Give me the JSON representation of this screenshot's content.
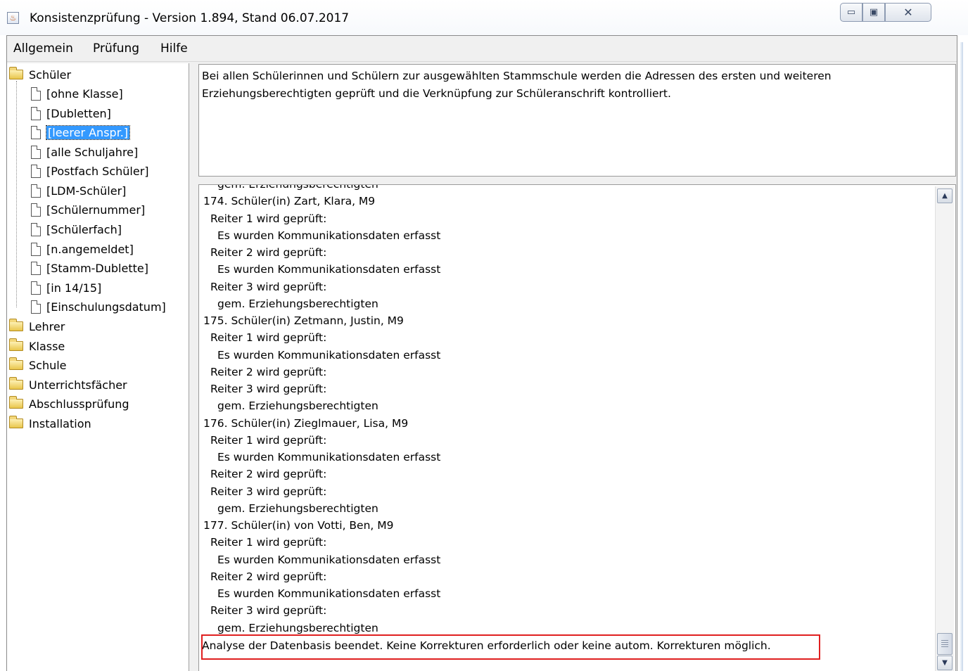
{
  "window": {
    "title": "Konsistenzprüfung - Version 1.894, Stand 06.07.2017",
    "minimize_glyph": "▭",
    "maximize_glyph": "▣",
    "close_glyph": "✕"
  },
  "menu": {
    "items": [
      "Allgemein",
      "Prüfung",
      "Hilfe"
    ]
  },
  "tree": {
    "root": "Schüler",
    "children": [
      "[ohne Klasse]",
      "[Dubletten]",
      "[leerer Anspr.]",
      "[alle Schuljahre]",
      "[Postfach Schüler]",
      "[LDM-Schüler]",
      "[Schülernummer]",
      "[Schülerfach]",
      "[n.angemeldet]",
      "[Stamm-Dublette]",
      "[in 14/15]",
      "[Einschulungsdatum]"
    ],
    "selected": "[leerer Anspr.]",
    "folders": [
      "Lehrer",
      "Klasse",
      "Schule",
      "Unterrichtsfächer",
      "Abschlussprüfung",
      "Installation"
    ]
  },
  "description": {
    "line1": "Bei allen Schülerinnen und Schülern zur ausgewählten Stammschule werden die Adressen des ersten und weiteren",
    "line2": "Erziehungsberechtigten geprüft und die Verknüpfung zur Schüleranschrift kontrolliert."
  },
  "log": {
    "lines": [
      "gem. Erziehungsberechtigten",
      "174. Schüler(in) Zart, Klara, M9",
      "Reiter 1 wird geprüft:",
      "Es wurden Kommunikationsdaten erfasst",
      "Reiter 2 wird geprüft:",
      "Es wurden Kommunikationsdaten erfasst",
      "Reiter 3 wird geprüft:",
      "gem. Erziehungsberechtigten",
      "175. Schüler(in) Zetmann, Justin, M9",
      "Reiter 1 wird geprüft:",
      "Es wurden Kommunikationsdaten erfasst",
      "Reiter 2 wird geprüft:",
      "Reiter 3 wird geprüft:",
      "gem. Erziehungsberechtigten",
      "176. Schüler(in) Zieglmauer, Lisa, M9",
      "Reiter 1 wird geprüft:",
      "Es wurden Kommunikationsdaten erfasst",
      "Reiter 2 wird geprüft:",
      "Reiter 3 wird geprüft:",
      "gem. Erziehungsberechtigten",
      "177. Schüler(in) von Votti, Ben, M9",
      "Reiter 1 wird geprüft:",
      "Es wurden Kommunikationsdaten erfasst",
      "Reiter 2 wird geprüft:",
      "Es wurden Kommunikationsdaten erfasst",
      "Reiter 3 wird geprüft:",
      "gem. Erziehungsberechtigten"
    ],
    "final": "Analyse der Datenbasis beendet. Keine Korrekturen erforderlich oder keine autom. Korrekturen möglich."
  },
  "scrollbar": {
    "up_glyph": "▲",
    "down_glyph": "▼"
  },
  "colors": {
    "selection": "#3399ff",
    "highlight_border": "#e02020"
  }
}
